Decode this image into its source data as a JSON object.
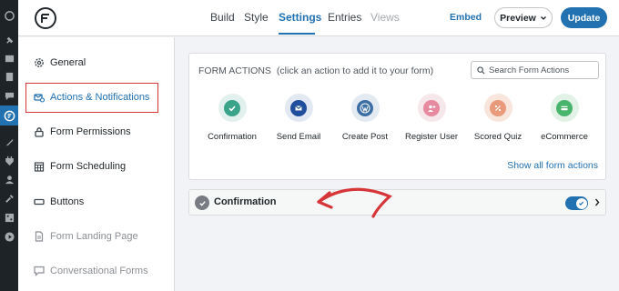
{
  "colors": {
    "accent": "#2271b1",
    "highlight_red": "#d63638",
    "wp_dark": "#1d2327"
  },
  "wp_admin_bar": {
    "icons": [
      "dashboard-icon",
      "pin-icon",
      "media-icon",
      "pages-icon",
      "comments-icon",
      "wpforms-icon",
      "appearance-icon",
      "plugins-icon",
      "users-icon",
      "tools-icon",
      "settings-icon",
      "play-icon"
    ]
  },
  "header": {
    "nav": [
      "Build",
      "Style",
      "Settings",
      "Entries",
      "Views"
    ],
    "active_nav": "Settings",
    "embed": "Embed",
    "preview": "Preview",
    "update": "Update"
  },
  "sidebar": {
    "items": [
      {
        "label": "General",
        "icon": "gear-icon"
      },
      {
        "label": "Actions & Notifications",
        "icon": "actions-icon"
      },
      {
        "label": "Form Permissions",
        "icon": "lock-icon"
      },
      {
        "label": "Form Scheduling",
        "icon": "calendar-icon"
      },
      {
        "label": "Buttons",
        "icon": "button-icon"
      },
      {
        "label": "Form Landing Page",
        "icon": "page-icon"
      },
      {
        "label": "Conversational Forms",
        "icon": "chat-icon"
      }
    ],
    "active": "Actions & Notifications"
  },
  "form_actions": {
    "title": "FORM ACTIONS",
    "hint": "(click an action to add it to your form)",
    "search_placeholder": "Search Form Actions",
    "actions": [
      {
        "label": "Confirmation",
        "icon": "check-icon",
        "bg": "#e3f1ee",
        "fg": "#3aa48a"
      },
      {
        "label": "Send Email",
        "icon": "envelope-icon",
        "bg": "#e3e9f3",
        "fg": "#1e4e9c"
      },
      {
        "label": "Create Post",
        "icon": "wordpress-icon",
        "bg": "#e4eaf1",
        "fg": "#3b6ea5"
      },
      {
        "label": "Register User",
        "icon": "add-user-icon",
        "bg": "#f5e7ea",
        "fg": "#e78a9f"
      },
      {
        "label": "Scored Quiz",
        "icon": "percent-icon",
        "bg": "#f8e6dd",
        "fg": "#e99a7a"
      },
      {
        "label": "eCommerce",
        "icon": "credit-card-icon",
        "bg": "#e2f2e6",
        "fg": "#49b56c"
      }
    ],
    "show_all": "Show all form actions"
  },
  "confirmation_row": {
    "label": "Confirmation",
    "enabled": true
  }
}
